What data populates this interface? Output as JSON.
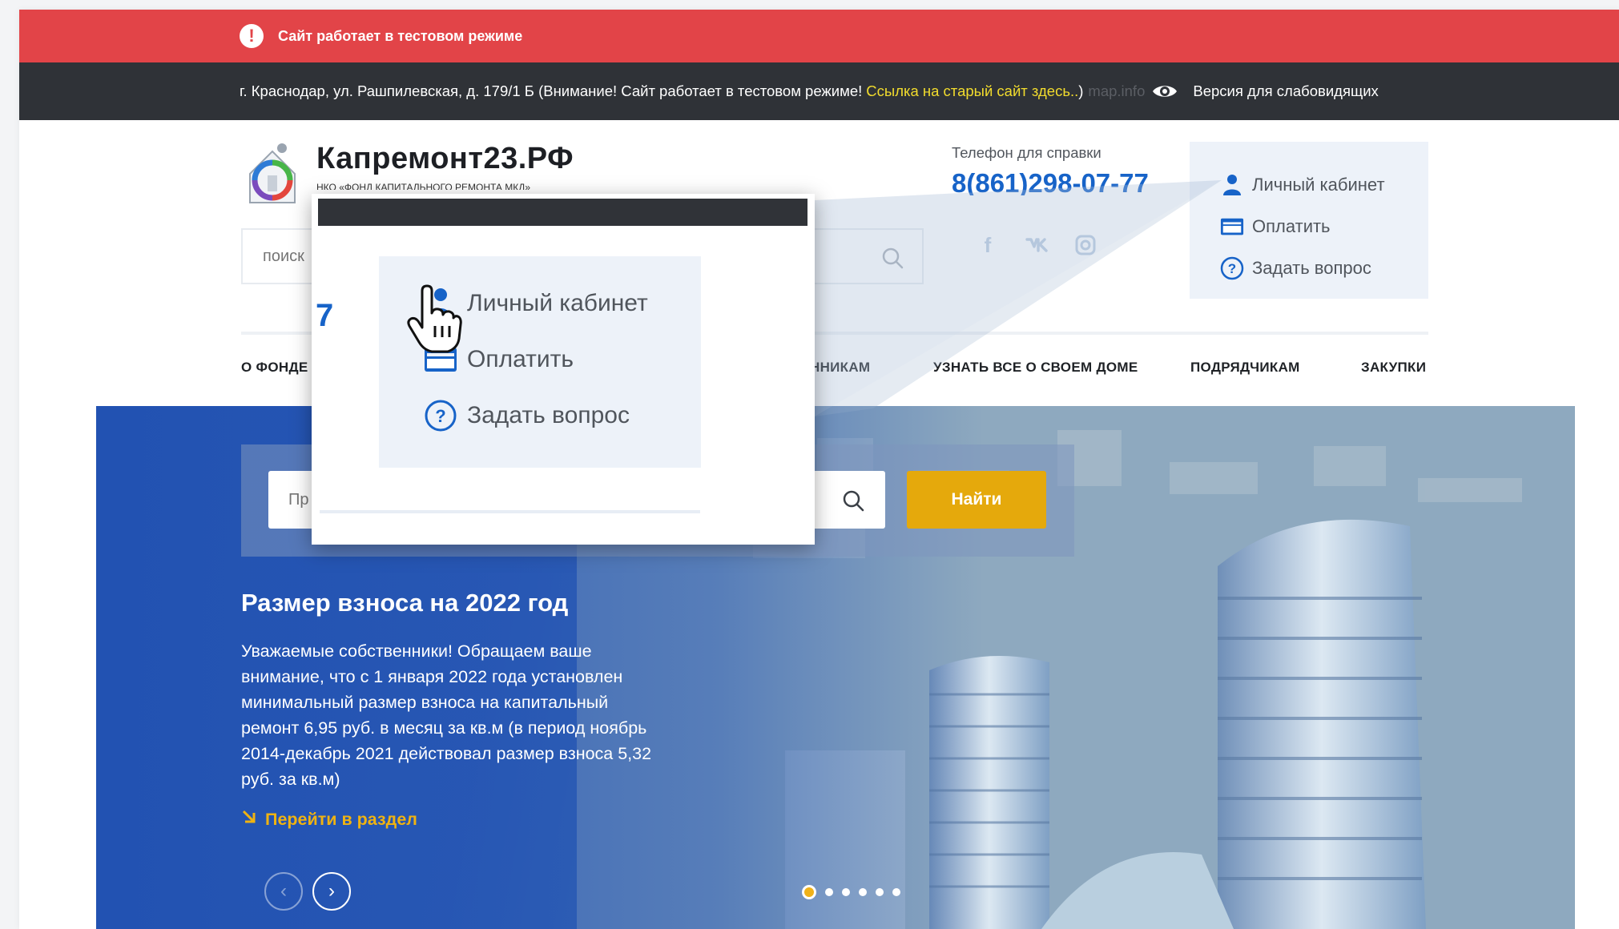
{
  "alert": {
    "text": "Сайт работает в тестовом режиме",
    "icon": "exclamation-icon"
  },
  "infobar": {
    "address": "г. Краснодар, ул. Рашпилевская, д. 179/1 Б (Внимание! Сайт работает в тестовом режиме!",
    "old_site_link": "Ссылка на старый сайт здесь..",
    "close_paren": ")",
    "mapinfo": "map.info",
    "accessibility": "Версия для слабовидящих"
  },
  "header": {
    "brand": "Капремонт23.РФ",
    "brand_sub": "НКО «ФОНД КАПИТАЛЬНОГО РЕМОНТА МКД»",
    "search_placeholder": "поиск",
    "phone_label": "Телефон для справки",
    "phone": "8(861)298-07-77",
    "social": [
      "f",
      "vk",
      "instagram"
    ]
  },
  "account": {
    "cabinet": "Личный кабинет",
    "pay": "Оплатить",
    "ask": "Задать вопрос"
  },
  "nav": [
    "О ФОНДЕ",
    "СОБСТВЕННИКАМ",
    "УЗНАТЬ ВСЕ О СВОЕМ ДОМЕ",
    "ПОДРЯДЧИКАМ",
    "ЗАКУПКИ"
  ],
  "nav_visible": {
    "about": "О ФОНДЕ",
    "owners_tail": "ННИКАМ",
    "house": "УЗНАТЬ ВСЕ О СВОЕМ ДОМЕ",
    "contractors": "ПОДРЯДЧИКАМ",
    "purchases": "ЗАКУПКИ"
  },
  "hero": {
    "search_placeholder": "Пр",
    "search_button": "Найти",
    "title": "Размер взноса на 2022 год",
    "text": "Уважаемые собственники! Обращаем ваше внимание, что с 1 января 2022 года установлен минимальный размер взноса на капитальный ремонт 6,95 руб. в месяц за кв.м (в период ноябрь 2014-декабрь 2021 действовал размер взноса 5,32 руб. за кв.м)",
    "link": "Перейти в раздел",
    "prev": "‹",
    "next": "›",
    "slides_total": 6,
    "slide_active": 1
  },
  "zoom": {
    "partial_digit": "7",
    "cabinet": "Личный кабинет",
    "pay": "Оплатить",
    "ask": "Задать вопрос"
  },
  "colors": {
    "alert_red": "#e24448",
    "dark_bar": "#2f3237",
    "link_yellow": "#f2dc2d",
    "brand_blue": "#1763c8",
    "button_gold": "#e5a90c",
    "panel_bg": "#edf2f9"
  }
}
